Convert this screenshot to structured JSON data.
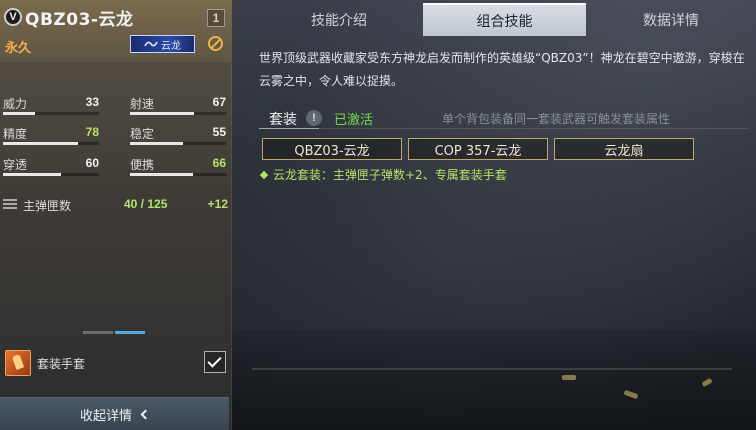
{
  "weapon": {
    "rank_icon_text": "V",
    "name": "QBZ03-云龙",
    "level": "1",
    "duration": "永久",
    "skin_tag": "云龙"
  },
  "stats": [
    {
      "label": "威力",
      "value": "33",
      "fill": 0.33,
      "highlight": false
    },
    {
      "label": "射速",
      "value": "67",
      "fill": 0.67,
      "highlight": false
    },
    {
      "label": "精度",
      "value": "78",
      "fill": 0.78,
      "highlight": true
    },
    {
      "label": "稳定",
      "value": "55",
      "fill": 0.55,
      "highlight": false
    },
    {
      "label": "穿透",
      "value": "60",
      "fill": 0.6,
      "highlight": false
    },
    {
      "label": "便携",
      "value": "66",
      "fill": 0.66,
      "highlight": true
    }
  ],
  "magazine": {
    "label": "主弹匣数",
    "value": "40 / 125",
    "bonus": "+12"
  },
  "set_item": {
    "label": "套装手套",
    "checked": true
  },
  "collapse_button": "收起详情",
  "tabs": [
    {
      "label": "技能介绍",
      "active": false
    },
    {
      "label": "组合技能",
      "active": true
    },
    {
      "label": "数据详情",
      "active": false
    }
  ],
  "description": "世界顶级武器收藏家受东方神龙启发而制作的英雄级“QBZ03”！神龙在碧空中遨游，穿梭在云雾之中，令人难以捉摸。",
  "set": {
    "label": "套装",
    "warn_icon": "!",
    "status": "已激活",
    "hint": "单个背包装备同一套装武器可触发套装属性",
    "pieces": [
      "QBZ03-云龙",
      "COP 357-云龙",
      "云龙扇"
    ],
    "bonus": "云龙套装：主弹匣子弹数+2、专属套装手套"
  },
  "colors": {
    "accent_green": "#b6e36a",
    "active_green": "#6fdc4c",
    "gold": "#f0b24a"
  }
}
